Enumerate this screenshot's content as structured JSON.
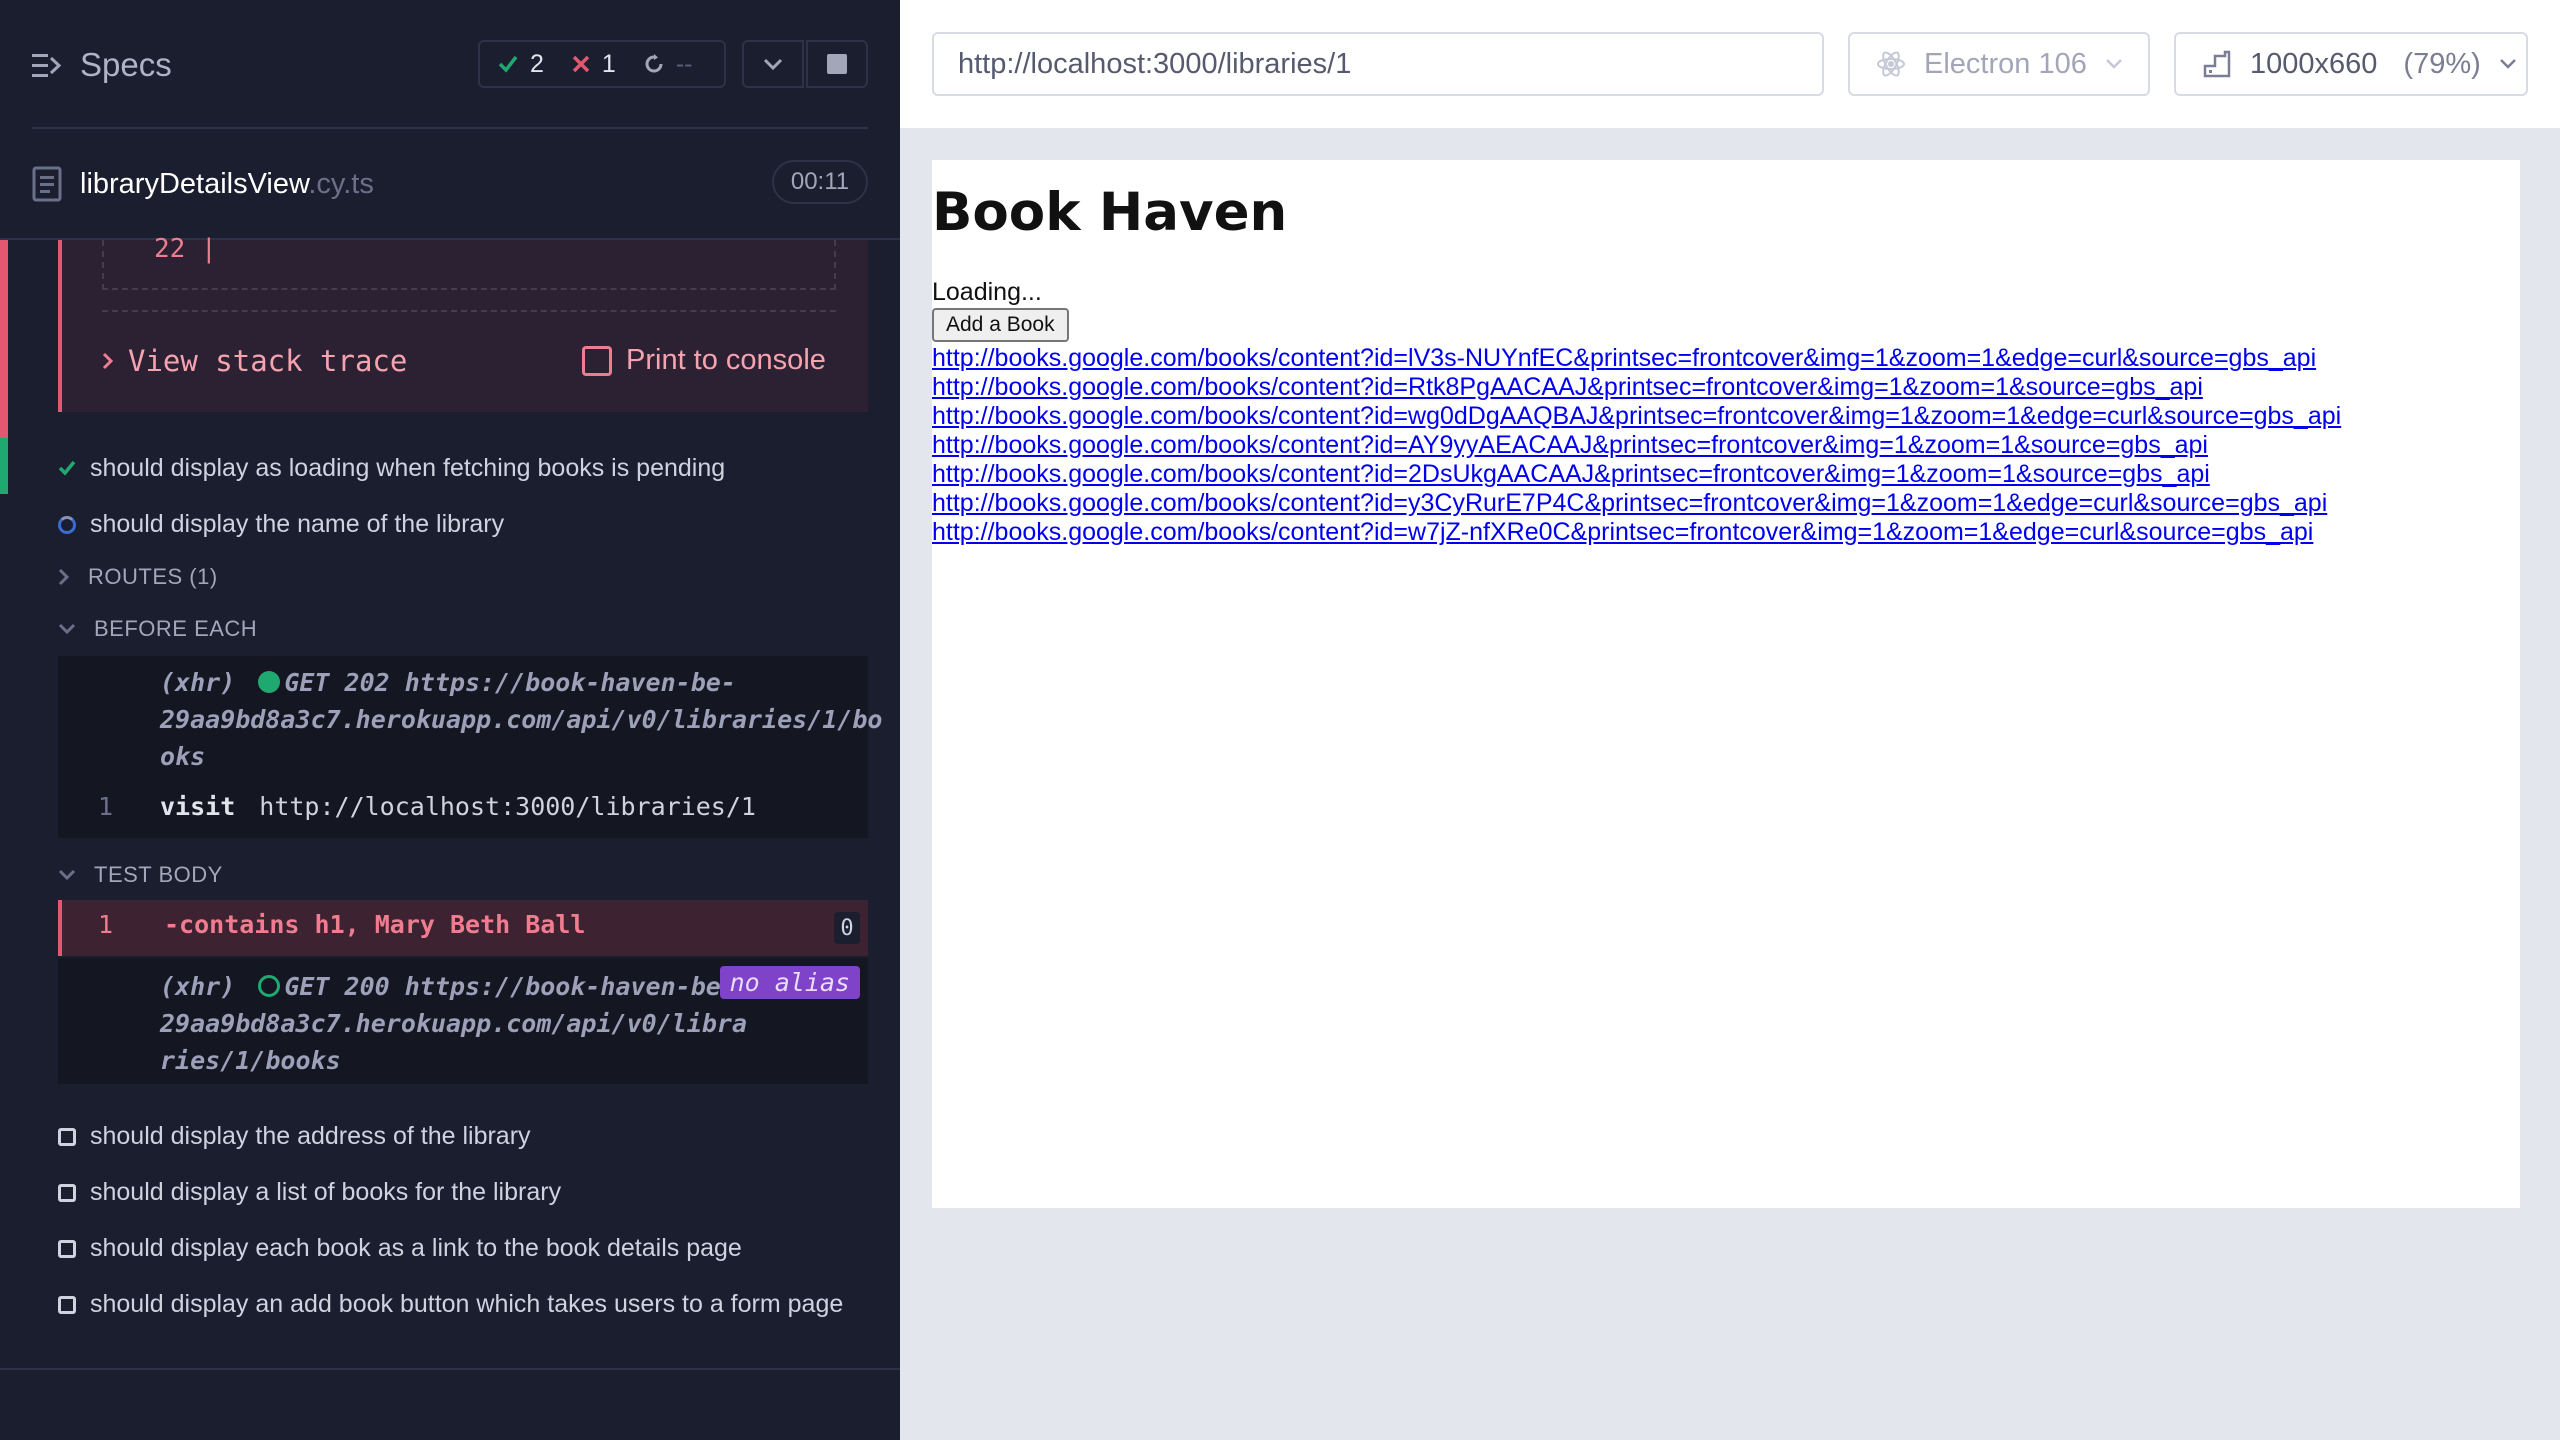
{
  "reporter": {
    "title": "Specs",
    "stats": {
      "passed": "2",
      "failed": "1",
      "pending": "--"
    },
    "spec": {
      "name": "libraryDetailsView",
      "ext": ".cy.ts",
      "duration": "00:11"
    },
    "error": {
      "code_line": "22 |",
      "view_stack_trace": "View stack trace",
      "print_to_console": "Print to console"
    },
    "tests": [
      {
        "label": "should display as loading when fetching books is pending",
        "state": "passed"
      },
      {
        "label": "should display the name of the library",
        "state": "running"
      },
      {
        "label": "should display the address of the library",
        "state": "pending"
      },
      {
        "label": "should display a list of books for the library",
        "state": "pending"
      },
      {
        "label": "should display each book as a link to the book details page",
        "state": "pending"
      },
      {
        "label": "should display an add book button which takes users to a form page",
        "state": "pending"
      }
    ],
    "routes_label": "ROUTES (1)",
    "before_each_label": "BEFORE EACH",
    "before_each": {
      "xhr_prefix": "(xhr)",
      "xhr_line1": "GET 202 https://book-haven-be-",
      "xhr_line2": "29aa9bd8a3c7.herokuapp.com/api/v0/libraries/1/bo",
      "xhr_line3": "oks",
      "visit_num": "1",
      "visit_cmd": "visit",
      "visit_url": "http://localhost:3000/libraries/1"
    },
    "test_body_label": "TEST BODY",
    "test_body": {
      "fail_num": "1",
      "fail_cmd": "-contains  h1, Mary Beth Ball",
      "fail_count": "0",
      "xhr_prefix": "(xhr)",
      "xhr_line1": "GET 200 https://book-haven-be-",
      "xhr_line2": "29aa9bd8a3c7.herokuapp.com/api/v0/libra",
      "xhr_line3": "ries/1/books",
      "alias": "no alias"
    }
  },
  "browser": {
    "url": "http://localhost:3000/libraries/1",
    "browser_name": "Electron 106",
    "viewport": "1000x660",
    "scale": "(79%)"
  },
  "app": {
    "title": "Book Haven",
    "loading": "Loading...",
    "add_button": "Add a Book",
    "links": [
      "http://books.google.com/books/content?id=lV3s-NUYnfEC&printsec=frontcover&img=1&zoom=1&edge=curl&source=gbs_api",
      "http://books.google.com/books/content?id=Rtk8PgAACAAJ&printsec=frontcover&img=1&zoom=1&source=gbs_api",
      "http://books.google.com/books/content?id=wg0dDgAAQBAJ&printsec=frontcover&img=1&zoom=1&edge=curl&source=gbs_api",
      "http://books.google.com/books/content?id=AY9yyAEACAAJ&printsec=frontcover&img=1&zoom=1&source=gbs_api",
      "http://books.google.com/books/content?id=2DsUkgAACAAJ&printsec=frontcover&img=1&zoom=1&source=gbs_api",
      "http://books.google.com/books/content?id=y3CyRurE7P4C&printsec=frontcover&img=1&zoom=1&edge=curl&source=gbs_api",
      "http://books.google.com/books/content?id=w7jZ-nfXRe0C&printsec=frontcover&img=1&zoom=1&edge=curl&source=gbs_api"
    ]
  },
  "colors": {
    "reporter_bg": "#1b1e2e",
    "passed": "#1fa971",
    "failed": "#e45770",
    "alias": "#7f43c9",
    "link": "#0000ee"
  }
}
